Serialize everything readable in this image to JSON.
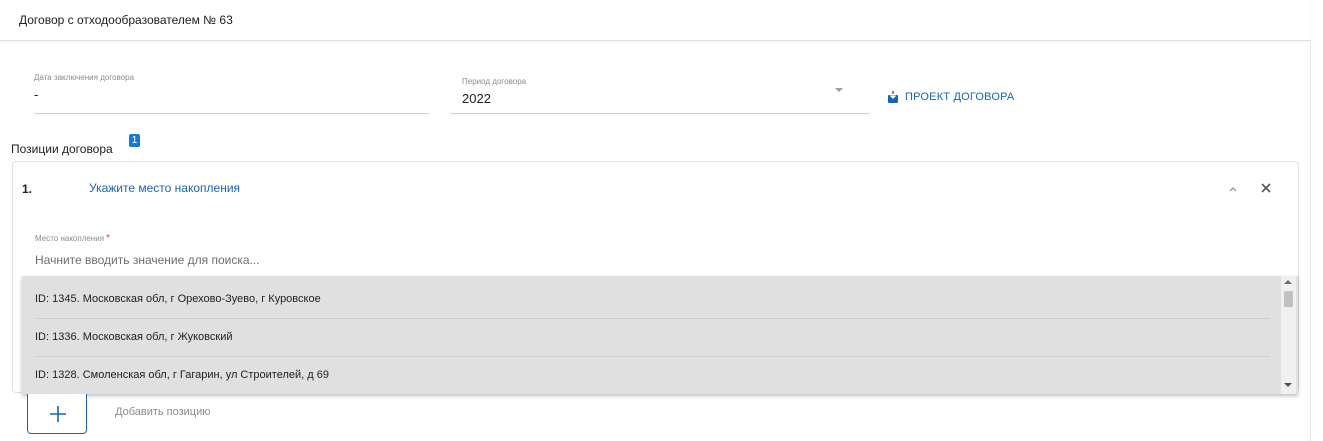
{
  "header": {
    "title": "Договор с отходообразователем № 63"
  },
  "contract": {
    "date_label": "Дата заключения договора",
    "date_value": "-",
    "period_label": "Период договора",
    "period_value": "2022",
    "project_button": "ПРОЕКТ ДОГОВОРА"
  },
  "positions": {
    "section_title": "Позиции договора",
    "count": "1",
    "items": [
      {
        "number": "1.",
        "title": "Укажите место накопления",
        "field_label": "Место накопления",
        "required_mark": "*",
        "search_placeholder": "Начните вводить значение для поиска..."
      }
    ],
    "options": [
      {
        "label": "ID: 1345. Московская обл, г Орехово-Зуево, г Куровское"
      },
      {
        "label": "ID: 1336. Московская обл, г Жуковский"
      },
      {
        "label": "ID: 1328. Смоленская обл, г Гагарин, ул Строителей, д 69"
      }
    ],
    "add_label": "Добавить позицию"
  },
  "colors": {
    "accent": "#1565c0",
    "badge": "#1976d2",
    "required": "#e53935"
  }
}
